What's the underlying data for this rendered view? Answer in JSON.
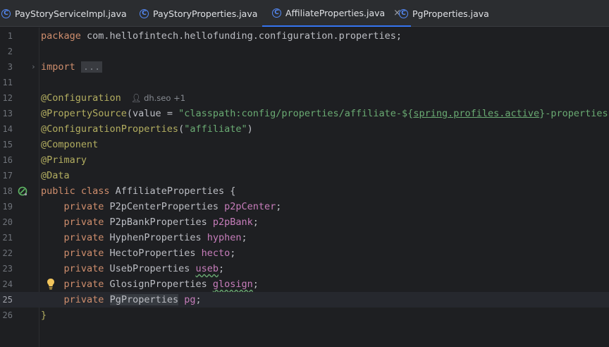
{
  "tabs": [
    {
      "label": "PayStoryServiceImpl.java",
      "icon": "class-icon"
    },
    {
      "label": "PayStoryProperties.java",
      "icon": "class-icon"
    },
    {
      "label": "AffiliateProperties.java",
      "icon": "class-icon",
      "active": true,
      "close": "×"
    },
    {
      "label": "PgProperties.java",
      "icon": "class-icon"
    }
  ],
  "class_icon_letter": "C",
  "lines": {
    "l1": {
      "num": "1",
      "package_kw": "package",
      "package_name": " com.hellofintech.hellofunding.configuration.properties;"
    },
    "l2": {
      "num": "2"
    },
    "l3": {
      "num": "3",
      "import_kw": "import",
      "folded": "..."
    },
    "l11": {
      "num": "11"
    },
    "l12": {
      "num": "12",
      "annotation": "@Configuration",
      "author_hint": "dh.seo +1"
    },
    "l13": {
      "num": "13",
      "annotation": "@PropertySource",
      "p1": "(value = ",
      "s1": "\"classpath:config/properties/affiliate-${",
      "s2": "spring.profiles.active",
      "s3": "}-properties.y"
    },
    "l14": {
      "num": "14",
      "annotation": "@ConfigurationProperties",
      "p1": "(",
      "s1": "\"affiliate\"",
      "p2": ")"
    },
    "l15": {
      "num": "15",
      "annotation": "@Component"
    },
    "l16": {
      "num": "16",
      "annotation": "@Primary"
    },
    "l17": {
      "num": "17",
      "annotation": "@Data"
    },
    "l18": {
      "num": "18",
      "kw": "public class",
      "name": " AffiliateProperties {"
    },
    "l19": {
      "num": "19",
      "kw": "private",
      "type": " P2pCenterProperties ",
      "field": "p2pCenter",
      "semi": ";"
    },
    "l20": {
      "num": "20",
      "kw": "private",
      "type": " P2pBankProperties ",
      "field": "p2pBank",
      "semi": ";"
    },
    "l21": {
      "num": "21",
      "kw": "private",
      "type": " HyphenProperties ",
      "field": "hyphen",
      "semi": ";"
    },
    "l22": {
      "num": "22",
      "kw": "private",
      "type": " HectoProperties ",
      "field": "hecto",
      "semi": ";"
    },
    "l23": {
      "num": "23",
      "kw": "private",
      "type": " UsebProperties ",
      "field": "useb",
      "semi": ";"
    },
    "l24": {
      "num": "24",
      "kw": "private",
      "type": " GlosignProperties ",
      "field": "glosign",
      "semi": ";"
    },
    "l25": {
      "num": "25",
      "kw": "private",
      "type": "PgProperties",
      "field": "pg",
      "semi": ";"
    },
    "l26": {
      "num": "26",
      "brace": "}"
    }
  },
  "colors": {
    "keyword": "#cf8e6d",
    "annotation": "#b3ae60",
    "string": "#6aab73",
    "field": "#c77dbb",
    "accent": "#3574f0"
  }
}
